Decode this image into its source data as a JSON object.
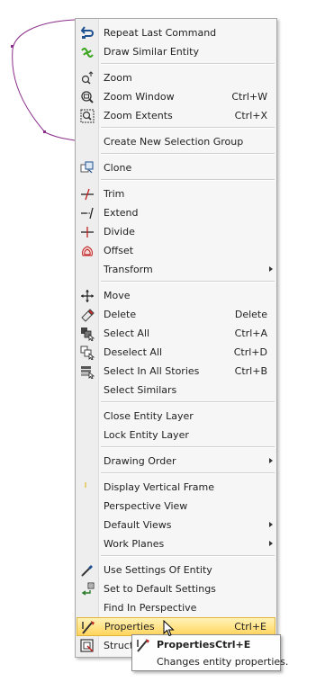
{
  "menu": {
    "items": [
      {
        "label": "Repeat Last Command",
        "shortcut": "",
        "icon": "repeat-icon"
      },
      {
        "label": "Draw Similar Entity",
        "shortcut": "",
        "icon": "draw-similar-icon"
      },
      {
        "label": "Zoom",
        "shortcut": "",
        "icon": "zoom-icon"
      },
      {
        "label": "Zoom Window",
        "shortcut": "Ctrl+W",
        "icon": "zoom-window-icon"
      },
      {
        "label": "Zoom Extents",
        "shortcut": "Ctrl+X",
        "icon": "zoom-extents-icon"
      },
      {
        "label": "Create New Selection Group",
        "shortcut": "",
        "icon": ""
      },
      {
        "label": "Clone",
        "shortcut": "",
        "icon": "clone-icon"
      },
      {
        "label": "Trim",
        "shortcut": "",
        "icon": "trim-icon"
      },
      {
        "label": "Extend",
        "shortcut": "",
        "icon": "extend-icon"
      },
      {
        "label": "Divide",
        "shortcut": "",
        "icon": "divide-icon"
      },
      {
        "label": "Offset",
        "shortcut": "",
        "icon": "offset-icon"
      },
      {
        "label": "Transform",
        "shortcut": "",
        "icon": ""
      },
      {
        "label": "Move",
        "shortcut": "",
        "icon": "move-icon"
      },
      {
        "label": "Delete",
        "shortcut": "Delete",
        "icon": "eraser-icon"
      },
      {
        "label": "Select All",
        "shortcut": "Ctrl+A",
        "icon": "select-all-icon"
      },
      {
        "label": "Deselect All",
        "shortcut": "Ctrl+D",
        "icon": "deselect-all-icon"
      },
      {
        "label": "Select In All Stories",
        "shortcut": "Ctrl+B",
        "icon": "select-stories-icon"
      },
      {
        "label": "Select Similars",
        "shortcut": "",
        "icon": ""
      },
      {
        "label": "Close Entity Layer",
        "shortcut": "",
        "icon": ""
      },
      {
        "label": "Lock Entity Layer",
        "shortcut": "",
        "icon": ""
      },
      {
        "label": "Drawing Order",
        "shortcut": "",
        "icon": ""
      },
      {
        "label": "Display Vertical Frame",
        "shortcut": "",
        "icon": ""
      },
      {
        "label": "Perspective View",
        "shortcut": "",
        "icon": ""
      },
      {
        "label": "Default Views",
        "shortcut": "",
        "icon": ""
      },
      {
        "label": "Work Planes",
        "shortcut": "",
        "icon": ""
      },
      {
        "label": "Use Settings Of Entity",
        "shortcut": "",
        "icon": "eyedropper-icon"
      },
      {
        "label": "Set to Default Settings",
        "shortcut": "",
        "icon": "default-settings-icon"
      },
      {
        "label": "Find In Perspective",
        "shortcut": "",
        "icon": ""
      },
      {
        "label": "Properties",
        "shortcut": "Ctrl+E",
        "icon": "properties-icon"
      },
      {
        "label": "Struct",
        "shortcut": "",
        "icon": "structure-icon"
      }
    ]
  },
  "tooltip": {
    "title": "Properties",
    "shortcut": "Ctrl+E",
    "description": "Changes entity properties."
  },
  "colors": {
    "highlight": "#ffd45c",
    "curve": "#8b2d8b"
  }
}
